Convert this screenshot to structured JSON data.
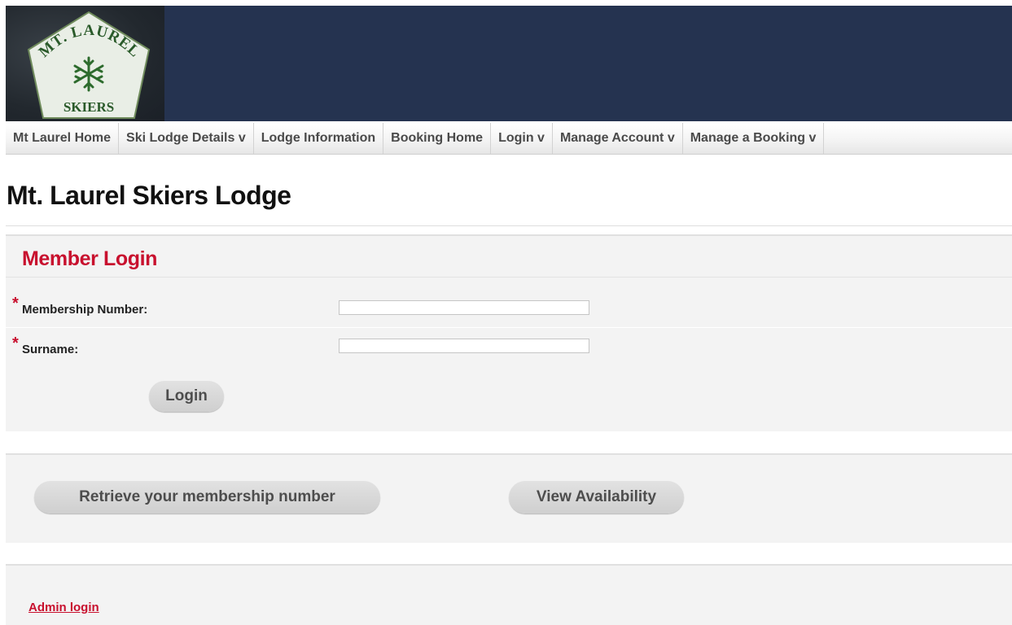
{
  "header": {
    "logo_text_top": "MT. LAUREL",
    "logo_text_bottom": "SKIERS",
    "logo_icon": "snowflake-icon",
    "banner_color": "#253350"
  },
  "nav": {
    "items": [
      {
        "label": "Mt Laurel Home"
      },
      {
        "label": "Ski Lodge Details v"
      },
      {
        "label": "Lodge Information"
      },
      {
        "label": "Booking Home"
      },
      {
        "label": "Login v"
      },
      {
        "label": "Manage Account v"
      },
      {
        "label": "Manage a Booking v"
      }
    ]
  },
  "page": {
    "title": "Mt. Laurel Skiers Lodge"
  },
  "login_form": {
    "heading": "Member Login",
    "required_marker": "*",
    "membership_label": "Membership Number:",
    "membership_value": "",
    "surname_label": "Surname:",
    "surname_value": "",
    "login_button": "Login"
  },
  "actions": {
    "retrieve_button": "Retrieve your membership number",
    "availability_button": "View Availability"
  },
  "footer": {
    "admin_link": "Admin login"
  },
  "colors": {
    "accent_red": "#c8102e",
    "panel_bg": "#f3f3f3"
  }
}
